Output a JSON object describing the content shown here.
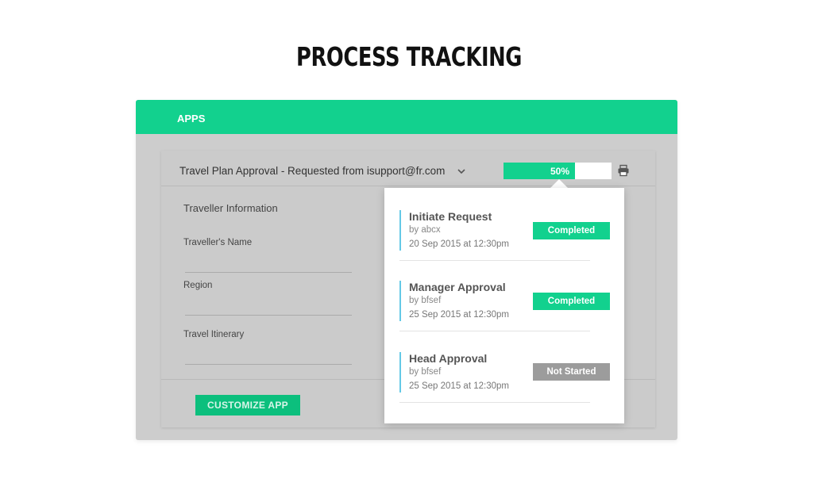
{
  "page_title": "PROCESS TRACKING",
  "app": {
    "header_title": "APPS",
    "request": {
      "title": "Travel Plan Approval - Requested from isupport@fr.com",
      "progress_percent": 50,
      "progress_label": "50%"
    },
    "form": {
      "section_title": "Traveller Information",
      "fields": [
        {
          "label": "Traveller's Name",
          "value": ""
        },
        {
          "label": "Region",
          "value": ""
        },
        {
          "label": "Travel Itinerary",
          "value": ""
        }
      ]
    },
    "customize_button": "CUSTOMIZE APP"
  },
  "tracker": {
    "steps": [
      {
        "name": "Initiate Request",
        "by": "by abcx",
        "time": "20 Sep 2015 at 12:30pm",
        "status": "Completed",
        "status_color": "#12d18e"
      },
      {
        "name": "Manager Approval",
        "by": "by bfsef",
        "time": "25 Sep 2015 at 12:30pm",
        "status": "Completed",
        "status_color": "#12d18e"
      },
      {
        "name": "Head Approval",
        "by": "by bfsef",
        "time": "25 Sep 2015 at 12:30pm",
        "status": "Not Started",
        "status_color": "#9c9c9c"
      }
    ]
  },
  "colors": {
    "accent": "#12d18e",
    "button": "#0cbf7d",
    "step_bar": "#64c9e6"
  },
  "icons": [
    "chevron-down-icon",
    "printer-icon"
  ]
}
